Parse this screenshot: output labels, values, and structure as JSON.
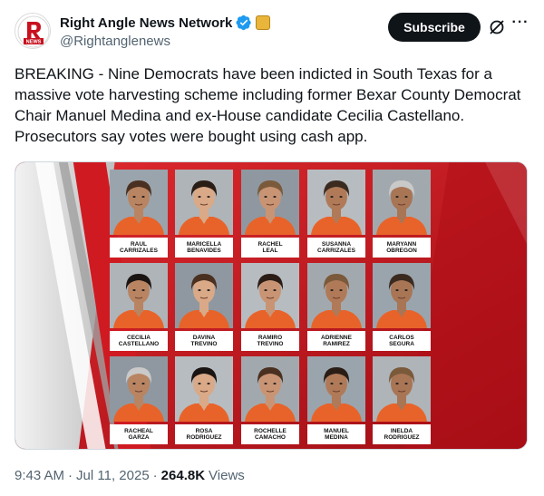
{
  "account": {
    "display_name": "Right Angle News Network",
    "handle": "@Rightanglenews",
    "avatar_text": "NEWS",
    "avatar_letter": "R"
  },
  "actions": {
    "subscribe_label": "Subscribe",
    "more_label": "···"
  },
  "tweet": {
    "text": "BREAKING - Nine Democrats have been indicted in South Texas for a massive vote harvesting scheme including former Bexar County Democrat Chair Manuel Medina and ex-House candidate Cecilia Castellano. Prosecutors say votes were bought using cash app."
  },
  "media": {
    "people": [
      {
        "first": "RAUL",
        "last": "CARRIZALES"
      },
      {
        "first": "MARICELLA",
        "last": "BENAVIDES"
      },
      {
        "first": "RACHEL",
        "last": "LEAL"
      },
      {
        "first": "SUSANNA",
        "last": "CARRIZALES"
      },
      {
        "first": "MARYANN",
        "last": "OBREGON"
      },
      {
        "first": "CECILIA",
        "last": "CASTELLANO"
      },
      {
        "first": "DAVINA",
        "last": "TREVINO"
      },
      {
        "first": "RAMIRO",
        "last": "TREVINO"
      },
      {
        "first": "ADRIENNE",
        "last": "RAMIREZ"
      },
      {
        "first": "CARLOS",
        "last": "SEGURA"
      },
      {
        "first": "RACHEAL",
        "last": "GARZA"
      },
      {
        "first": "ROSA",
        "last": "RODRIGUEZ"
      },
      {
        "first": "ROCHELLE",
        "last": "CAMACHO"
      },
      {
        "first": "MANUEL",
        "last": "MEDINA"
      },
      {
        "first": "INELDA",
        "last": "RODRIGUEZ"
      }
    ]
  },
  "footer": {
    "time": "9:43 AM",
    "separator": "·",
    "date": "Jul 11, 2025",
    "separator2": "·",
    "views_count": "264.8K",
    "views_label": "Views"
  },
  "colors": {
    "verified": "#1d9bf0",
    "banner_red": "#c0121b",
    "jumpsuit": "#e8632a",
    "text_secondary": "#536471"
  },
  "icons": [
    "verified-badge-icon",
    "affiliate-badge-icon",
    "grok-icon",
    "more-icon"
  ]
}
